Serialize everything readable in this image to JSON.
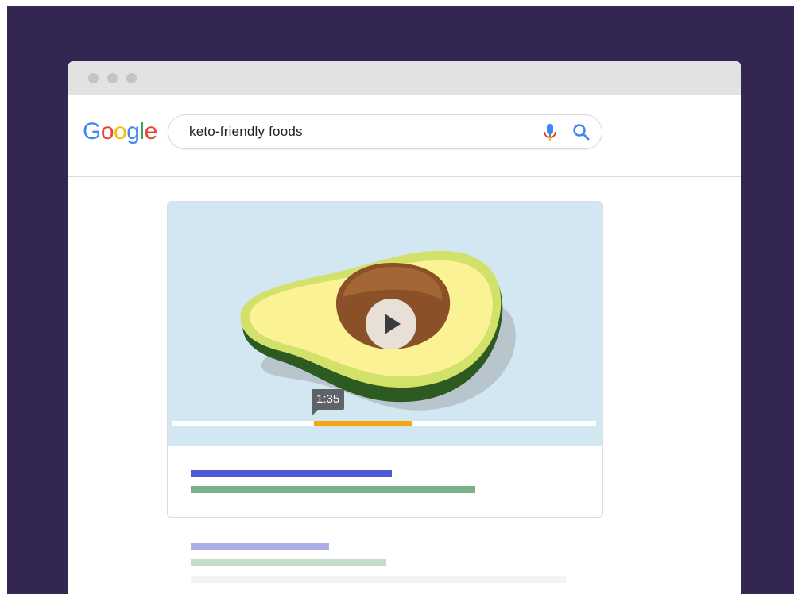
{
  "search": {
    "logo_letters": [
      {
        "char": "G",
        "color": "#4285F4"
      },
      {
        "char": "o",
        "color": "#EA4335"
      },
      {
        "char": "o",
        "color": "#FBBC05"
      },
      {
        "char": "g",
        "color": "#4285F4"
      },
      {
        "char": "l",
        "color": "#34A853"
      },
      {
        "char": "e",
        "color": "#EA4335"
      }
    ],
    "query": "keto-friendly foods",
    "icons": [
      "mic-icon",
      "search-icon"
    ]
  },
  "video": {
    "timestamp": "1:35",
    "progress_highlight_start": 0.33,
    "progress_highlight_end": 0.57,
    "accent_color": "#f6a40f"
  },
  "colors": {
    "backdrop": "#332652",
    "title_link_placeholder": "#4f5bd5",
    "url_placeholder": "#7cb087"
  }
}
